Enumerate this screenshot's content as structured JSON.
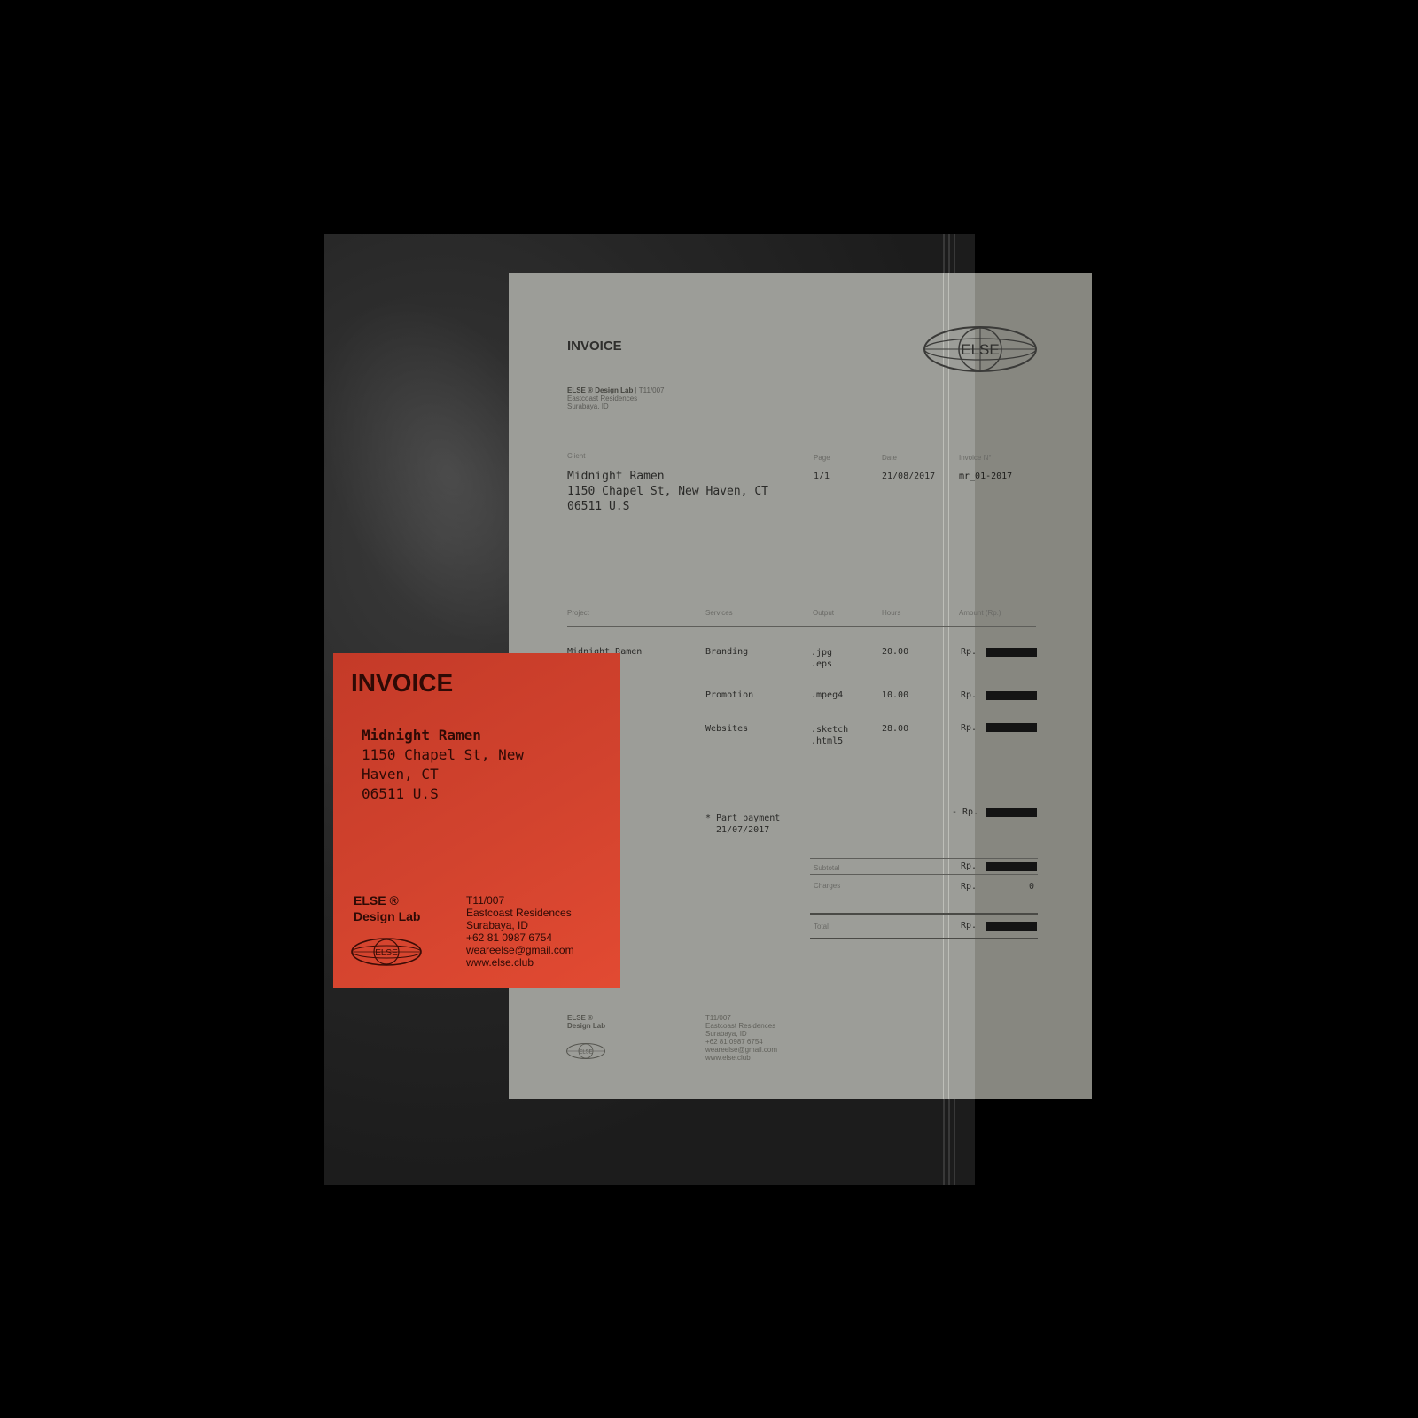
{
  "sheet": {
    "title": "INVOICE",
    "logo": "ELSE",
    "sender": {
      "name": "ELSE ® Design Lab",
      "ref": " | T11/007",
      "line1": "Eastcoast Residences",
      "line2": "Surabaya, ID"
    },
    "client": {
      "label": "Client",
      "name": "Midnight Ramen",
      "address1": "1150 Chapel St, New Haven, CT",
      "address2": "06511 U.S"
    },
    "meta": {
      "page_label": "Page",
      "page_value": "1/1",
      "date_label": "Date",
      "date_value": "21/08/2017",
      "invoice_label": "Invoice N°",
      "invoice_value": "mr_01-2017"
    },
    "table": {
      "headers": [
        "Project",
        "Services",
        "Output",
        "Hours",
        "Amount (Rp.)"
      ],
      "project": "Midnight Ramen",
      "rows": [
        {
          "service": "Branding",
          "output1": ".jpg",
          "output2": ".eps",
          "hours": "20.00",
          "currency": "Rp."
        },
        {
          "service": "Promotion",
          "output1": ".mpeg4",
          "output2": "",
          "hours": "10.00",
          "currency": "Rp."
        },
        {
          "service": "Websites",
          "output1": ".sketch",
          "output2": ".html5",
          "hours": "28.00",
          "currency": "Rp."
        }
      ]
    },
    "payment": {
      "note1": "* Part payment",
      "note2": "  21/07/2017",
      "currency": "- Rp."
    },
    "totals": {
      "subtotal_label": "Subtotal",
      "subtotal_currency": "Rp.",
      "charges_label": "Charges",
      "charges_currency": "Rp.",
      "charges_value": "0",
      "total_label": "Total",
      "total_currency": "Rp."
    },
    "footer": {
      "brand1": "ELSE ®",
      "brand2": "Design Lab",
      "logo": "ELSE",
      "lines": [
        "T11/007",
        "Eastcoast Residences",
        "Surabaya, ID",
        "+62 81 0987 6754",
        "weareelse@gmail.com",
        "www.else.club"
      ]
    }
  },
  "card": {
    "title": "INVOICE",
    "client_name": "Midnight Ramen",
    "address1": "1150 Chapel St, New",
    "address2": "Haven, CT",
    "address3": "06511 U.S",
    "brand1": "ELSE ®",
    "brand2": "Design Lab",
    "logo": "ELSE",
    "contact": [
      "T11/007",
      "Eastcoast Residences",
      "Surabaya, ID",
      "+62 81 0987 6754",
      "weareelse@gmail.com",
      "www.else.club"
    ]
  },
  "colors": {
    "card_red": "#d2432e",
    "sheet_gray": "#9c9d98",
    "folder_dark": "#262626",
    "background": "#000000"
  }
}
